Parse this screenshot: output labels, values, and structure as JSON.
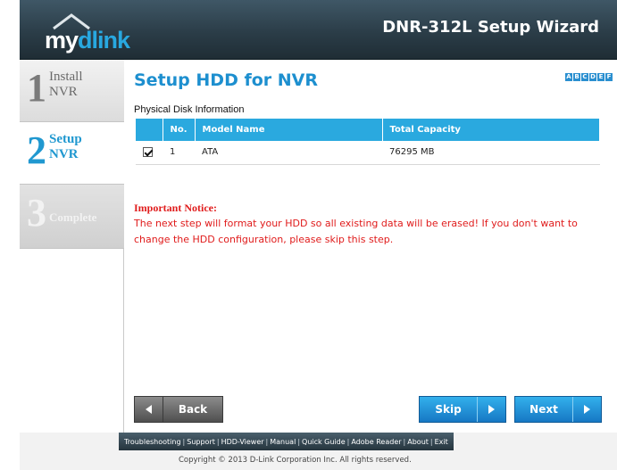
{
  "header": {
    "logo_my": "my",
    "logo_dlink": "dlink",
    "wizard_title": "DNR-312L Setup Wizard"
  },
  "sidebar": {
    "steps": [
      {
        "num": "1",
        "line1": "Install",
        "line2": "NVR",
        "state": "done"
      },
      {
        "num": "2",
        "line1": "Setup",
        "line2": "NVR",
        "state": "active"
      },
      {
        "num": "3",
        "line1": "Complete",
        "line2": "",
        "state": "pending"
      }
    ]
  },
  "main": {
    "title": "Setup HDD for NVR",
    "lang_icons": [
      "A",
      "B",
      "C",
      "D",
      "E",
      "F"
    ],
    "section_label": "Physical Disk Information",
    "table": {
      "headers": [
        "",
        "No.",
        "Model Name",
        "Total Capacity"
      ],
      "rows": [
        {
          "checked": true,
          "no": "1",
          "model": "ATA",
          "capacity": "76295 MB"
        }
      ]
    },
    "notice_title": "Important Notice:",
    "notice_text": "The next step will format your HDD so all existing data will be erased! If you don't want to change the HDD configuration, please skip this step."
  },
  "buttons": {
    "back": "Back",
    "skip": "Skip",
    "next": "Next"
  },
  "footer": {
    "links": [
      "Troubleshooting",
      "Support",
      "HDD-Viewer",
      "Manual",
      "Quick Guide",
      "Adobe Reader",
      "About",
      "Exit"
    ],
    "copyright": "Copyright © 2013 D-Link Corporation Inc. All rights reserved."
  },
  "colors": {
    "accent": "#2aa9df",
    "title_blue": "#1d8fcf",
    "notice_red": "#e01b1b",
    "header_dark": "#2b3d48"
  }
}
